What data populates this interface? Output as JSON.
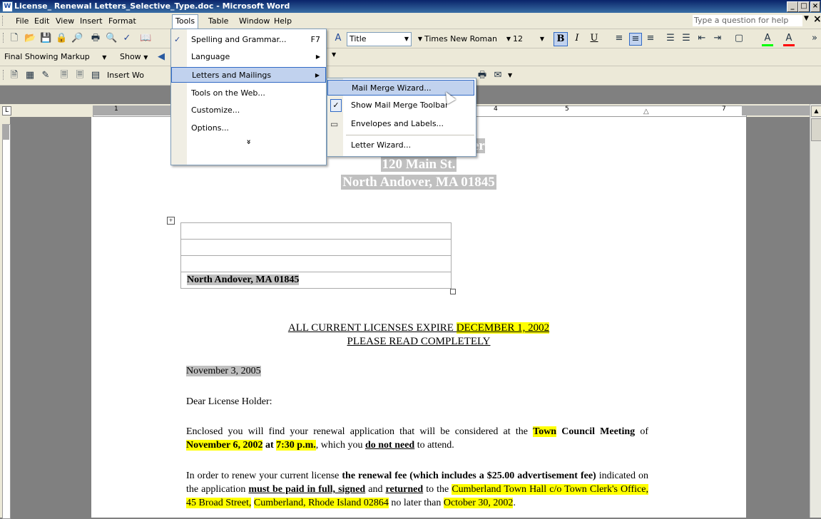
{
  "window": {
    "title": "License_ Renewal Letters_Selective_Type.doc - Microsoft Word",
    "app_icon": "W"
  },
  "window_buttons": {
    "minimize": "_",
    "maximize": "□",
    "close": "×"
  },
  "menubar": {
    "items": [
      "File",
      "Edit",
      "View",
      "Insert",
      "Format",
      "Tools",
      "Table",
      "Window",
      "Help"
    ],
    "help_placeholder": "Type a question for help",
    "close_doc": "×"
  },
  "formatting": {
    "style": "Title",
    "font": "Times New Roman",
    "size": "12",
    "bold": "B",
    "italic": "I",
    "underline": "U"
  },
  "reviewing": {
    "display": "Final Showing Markup",
    "show": "Show"
  },
  "mailmerge": {
    "insert_label": "Insert Wo"
  },
  "tools_menu": {
    "items": [
      {
        "label": "Spelling and Grammar...",
        "shortcut": "F7"
      },
      {
        "label": "Language",
        "submenu": true
      },
      {
        "label": "Letters and Mailings",
        "submenu": true
      },
      {
        "label": "Tools on the Web..."
      },
      {
        "label": "Customize..."
      },
      {
        "label": "Options..."
      }
    ],
    "expand": "»"
  },
  "letters_submenu": {
    "items": [
      "Mail Merge Wizard...",
      "Show Mail Merge Toolbar",
      "Envelopes and Labels...",
      "Letter Wizard..."
    ]
  },
  "ruler": {
    "marks": [
      "1",
      "4",
      "5",
      "7"
    ]
  },
  "document": {
    "header_lines": [
      "over",
      "120 Main St.",
      "North Andover, MA 01845"
    ],
    "address_last": "North Andover,  MA 01845",
    "heading1_pre": "ALL CURRENT LICENSES EXPIRE ",
    "heading1_hl": "DECEMBER 1, 2002",
    "heading2": "PLEASE READ COMPLETELY",
    "date": "November 3, 2005",
    "salutation": "Dear License Holder:",
    "p1": {
      "a": "Enclosed you will find your renewal application that will be considered at the ",
      "b": "Town",
      "c": "Council Meeting",
      "d": " of ",
      "e": "November 6, 2002",
      "f": " at ",
      "g": "7:30 p.m.",
      "h": ", which you ",
      "i": "do not need",
      "j": " to attend."
    },
    "p2": {
      "a": "In order to renew your current license ",
      "b": "the renewal fee (which includes a $25.00 advertisement fee)",
      "c": " indicated on the application ",
      "d": "must be paid in full, signed",
      "e": " and ",
      "f": "returned",
      "g": " to the ",
      "h": "Cumberland Town Hall c/o Town Clerk's Office, 45 Broad Street,",
      "i": "Cumberland, Rhode Island 02864",
      "j": " no later than ",
      "k": "October 30, 2002",
      "l": "."
    }
  },
  "colors": {
    "highlight": "#ffff00",
    "field_shade": "#c0c0c0",
    "menu_select": "#c1d2ee"
  }
}
